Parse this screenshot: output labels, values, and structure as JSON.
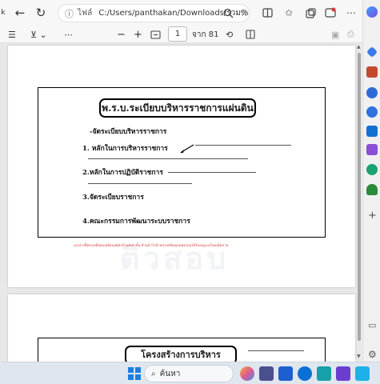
{
  "browser": {
    "site_label": "ไฟล์",
    "url": "C:/Users/panthakan/Downloads/รวม%..."
  },
  "pdf_toolbar": {
    "zoom_out": "−",
    "zoom_in": "+",
    "current_page": "1",
    "page_of": "จาก 81"
  },
  "document": {
    "title": "พ.ร.บ.ระเบียบบริหารราชการแผ่นดิน",
    "subheading": "-จัดระเบียบบริหารราชการ",
    "items": [
      "1. หลักในการบริหารราชการ",
      "2.หลักในการปฏิบัติราชการ",
      "3.จัดระเบียบราชการ",
      "4.คณะกรรมการพัฒนาระบบราชการ"
    ],
    "footer_note": "เอกสารนี้ทรงเหลือผมเหมือนสมัครบัวแต่เท่านั้น ห้ามนำไปจำหน่ายหรือเผยแพร่ก่อนได้รับอนุญาตโดยเด็ดขาด",
    "watermark": "ติวสอบ",
    "page2_title": "โครงสร้างการบริหารราชการ"
  },
  "taskbar": {
    "search_placeholder": "ค้นหา"
  },
  "colors": {
    "footer_red": "#d63a3a",
    "edge_blue": "#0a6fd6",
    "taskbar_bg": "#dfe6ee"
  }
}
